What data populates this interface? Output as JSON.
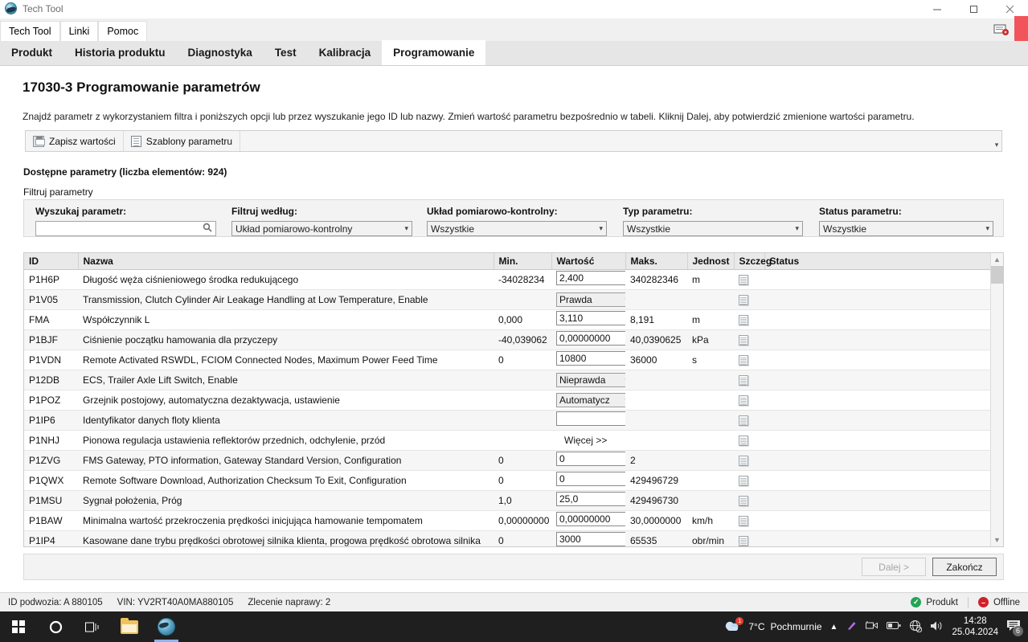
{
  "window": {
    "title": "Tech Tool",
    "icon": "globe-icon",
    "minimize": "–",
    "maximize": "❐",
    "close": "✕"
  },
  "menubar": {
    "items": [
      {
        "label": "Tech Tool"
      },
      {
        "label": "Linki"
      },
      {
        "label": "Pomoc"
      }
    ]
  },
  "tabs": [
    {
      "label": "Produkt",
      "active": false
    },
    {
      "label": "Historia produktu",
      "active": false
    },
    {
      "label": "Diagnostyka",
      "active": false
    },
    {
      "label": "Test",
      "active": false
    },
    {
      "label": "Kalibracja",
      "active": false
    },
    {
      "label": "Programowanie",
      "active": true
    }
  ],
  "page": {
    "title": "17030-3 Programowanie parametrów",
    "description": "Znajdź parametr z wykorzystaniem filtra i poniższych opcji lub przez wyszukanie jego ID lub nazwy. Zmień wartość parametru bezpośrednio w tabeli. Kliknij Dalej, aby potwierdzić zmienione wartości parametru.",
    "available_label": "Dostępne parametry (liczba elementów: 924)",
    "filter_label": "Filtruj parametry"
  },
  "toolbar": {
    "save_label": "Zapisz wartości",
    "templates_label": "Szablony parametru",
    "overflow": "▾"
  },
  "filters": [
    {
      "label": "Wyszukaj parametr:",
      "type": "search",
      "value": "",
      "placeholder": ""
    },
    {
      "label": "Filtruj według:",
      "type": "select",
      "value": "Układ pomiarowo-kontrolny"
    },
    {
      "label": "Układ pomiarowo-kontrolny:",
      "type": "select",
      "value": "Wszystkie"
    },
    {
      "label": "Typ parametru:",
      "type": "select",
      "value": "Wszystkie"
    },
    {
      "label": "Status parametru:",
      "type": "select",
      "value": "Wszystkie"
    }
  ],
  "table": {
    "columns": [
      "ID",
      "Nazwa",
      "Min.",
      "Wartość",
      "Maks.",
      "Jednost",
      "Szczeg",
      "Status"
    ],
    "rows": [
      {
        "id": "P1H6P",
        "name": "Długość węża ciśnieniowego środka redukującego",
        "min": "-34028234 ",
        "value": "2,400",
        "value_type": "input",
        "max": "340282346",
        "unit": "m",
        "status": ""
      },
      {
        "id": "P1V05",
        "name": "Transmission, Clutch Cylinder Air Leakage Handling at Low Temperature, Enable",
        "min": "",
        "value": "Prawda",
        "value_type": "select",
        "max": "",
        "unit": "",
        "status": ""
      },
      {
        "id": "FMA",
        "name": "Współczynnik L",
        "min": "0,000",
        "value": "3,110",
        "value_type": "input",
        "max": "8,191",
        "unit": "m",
        "status": ""
      },
      {
        "id": "P1BJF",
        "name": "Ciśnienie początku hamowania dla przyczepy",
        "min": "-40,039062",
        "value": "0,00000000",
        "value_type": "input",
        "max": "40,0390625",
        "unit": "kPa",
        "status": ""
      },
      {
        "id": "P1VDN",
        "name": "Remote Activated RSWDL, FCIOM Connected Nodes, Maximum Power Feed Time",
        "min": "0",
        "value": "10800",
        "value_type": "input",
        "max": "36000",
        "unit": "s",
        "status": ""
      },
      {
        "id": "P12DB",
        "name": "ECS, Trailer Axle Lift Switch, Enable",
        "min": "",
        "value": "Nieprawda",
        "value_type": "select",
        "max": "",
        "unit": "",
        "status": ""
      },
      {
        "id": "P1POZ",
        "name": "Grzejnik postojowy, automatyczna dezaktywacja, ustawienie",
        "min": "",
        "value": "Automatycz",
        "value_type": "select",
        "max": "",
        "unit": "",
        "status": ""
      },
      {
        "id": "P1IP6",
        "name": "Identyfikator danych floty klienta",
        "min": "",
        "value": "",
        "value_type": "input",
        "max": "",
        "unit": "",
        "status": ""
      },
      {
        "id": "P1NHJ",
        "name": "Pionowa regulacja ustawienia reflektorów przednich, odchylenie, przód",
        "min": "",
        "value": "Więcej >>",
        "value_type": "link",
        "max": "",
        "unit": "",
        "status": ""
      },
      {
        "id": "P1ZVG",
        "name": "FMS Gateway, PTO information, Gateway Standard Version, Configuration",
        "min": "0",
        "value": "0",
        "value_type": "input",
        "max": "2",
        "unit": "",
        "status": ""
      },
      {
        "id": "P1QWX",
        "name": "Remote Software Download, Authorization Checksum To Exit, Configuration",
        "min": "0",
        "value": "0",
        "value_type": "input",
        "max": "429496729",
        "unit": "",
        "status": ""
      },
      {
        "id": "P1MSU",
        "name": "Sygnał położenia, Próg",
        "min": "1,0",
        "value": "25,0",
        "value_type": "input",
        "max": "429496730",
        "unit": "",
        "status": ""
      },
      {
        "id": "P1BAW",
        "name": "Minimalna wartość przekroczenia prędkości inicjująca hamowanie tempomatem",
        "min": "0,00000000",
        "value": "0,00000000",
        "value_type": "input",
        "max": "30,0000000",
        "unit": "km/h",
        "status": ""
      },
      {
        "id": "P1IP4",
        "name": "Kasowane dane trybu prędkości obrotowej silnika klienta, progowa prędkość obrotowa silnika",
        "min": "0",
        "value": "3000",
        "value_type": "input",
        "max": "65535",
        "unit": "obr/min",
        "status": ""
      }
    ]
  },
  "footer": {
    "next_label": "Dalej >",
    "finish_label": "Zakończ"
  },
  "statusbar": {
    "chassis_id": "ID podwozia: A 880105",
    "vin": "VIN: YV2RT40A0MA880105",
    "repair_order": "Zlecenie naprawy: 2",
    "product_label": "Produkt",
    "connection_label": "Offline"
  },
  "taskbar": {
    "weather_temp": "7°C",
    "weather_desc": "Pochmurnie",
    "time": "14:28",
    "date": "25.04.2024",
    "notification_count": "6"
  },
  "colors": {
    "accent_red": "#f2545b",
    "status_ok": "#23a455",
    "status_off": "#d0202a",
    "tab_active_bg": "#ffffff",
    "panel_bg": "#f3f3f3"
  }
}
